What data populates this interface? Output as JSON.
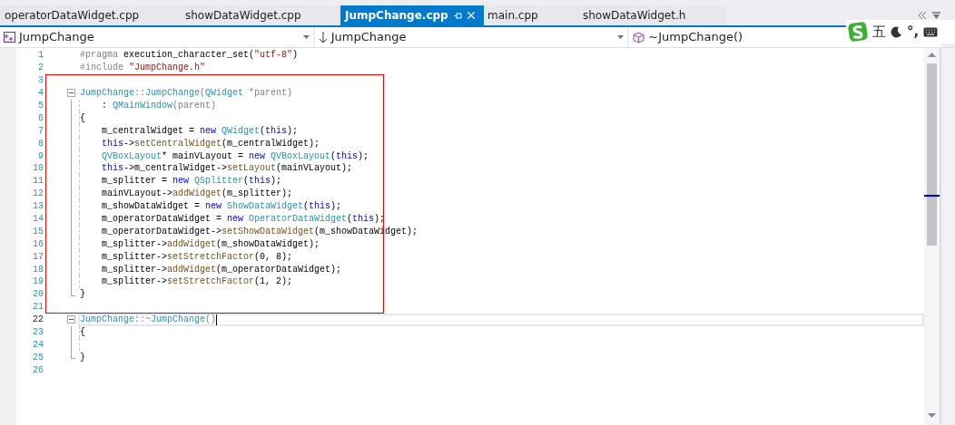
{
  "tabs": [
    {
      "label": "operatorDataWidget.cpp",
      "selected": false
    },
    {
      "label": "showDataWidget.cpp",
      "selected": false
    },
    {
      "label": "JumpChange.cpp",
      "selected": true
    },
    {
      "label": "main.cpp",
      "selected": false
    },
    {
      "label": "showDataWidget.h",
      "selected": false
    }
  ],
  "navigation": [
    {
      "kind": "class",
      "label": "JumpChange"
    },
    {
      "kind": "scope",
      "label": "JumpChange"
    },
    {
      "kind": "member",
      "label": "~JumpChange()"
    }
  ],
  "ime_toolbar": {
    "mode": "五",
    "punctuation": "°,"
  },
  "sections": [
    {
      "boxed": false,
      "lines": [
        {
          "number": "1",
          "kind": "plain",
          "current": false,
          "indented": false,
          "tokens": [
            {
              "kind": "pp",
              "text": "#pragma"
            },
            {
              "kind": "plain",
              "text": " execution_character_set("
            },
            {
              "kind": "str",
              "text": "\"utf-8\""
            },
            {
              "kind": "plain",
              "text": ")"
            }
          ]
        },
        {
          "number": "2",
          "kind": "plain",
          "current": false,
          "indented": false,
          "tokens": [
            {
              "kind": "pp",
              "text": "#include "
            },
            {
              "kind": "str",
              "text": "\"JumpChange.h\""
            }
          ]
        }
      ]
    },
    {
      "boxed": true,
      "lines": [
        {
          "number": "3",
          "kind": "plain",
          "current": false,
          "indented": false
        },
        {
          "number": "4",
          "kind": "fold-start",
          "current": false,
          "indented": false,
          "tokens": [
            {
              "kind": "type",
              "text": "JumpChange"
            },
            {
              "kind": "pp",
              "text": "::"
            },
            {
              "kind": "type",
              "text": "JumpChange"
            },
            {
              "kind": "pp",
              "text": "("
            },
            {
              "kind": "type",
              "text": "QWidget "
            },
            {
              "kind": "param",
              "text": "*parent"
            },
            {
              "kind": "pp",
              "text": ")"
            }
          ]
        },
        {
          "number": "5",
          "kind": "block",
          "current": false,
          "indented": true,
          "tokens": [
            {
              "kind": "plain",
              "text": ": "
            },
            {
              "kind": "type",
              "text": "QMainWindow"
            },
            {
              "kind": "param",
              "text": "(parent)"
            }
          ]
        },
        {
          "number": "6",
          "kind": "block",
          "current": false,
          "indented": false,
          "tokens": [
            {
              "kind": "plain",
              "text": "{"
            }
          ]
        },
        {
          "number": "7",
          "kind": "block",
          "current": false,
          "indented": true,
          "tokens": [
            {
              "kind": "plain",
              "text": "m_centralWidget = "
            },
            {
              "kind": "kw",
              "text": "new "
            },
            {
              "kind": "type",
              "text": "QWidget"
            },
            {
              "kind": "plain",
              "text": "("
            },
            {
              "kind": "kw",
              "text": "this"
            },
            {
              "kind": "plain",
              "text": ");"
            }
          ]
        },
        {
          "number": "8",
          "kind": "block",
          "current": false,
          "indented": true,
          "tokens": [
            {
              "kind": "kw",
              "text": "this"
            },
            {
              "kind": "plain",
              "text": "->"
            },
            {
              "kind": "fn",
              "text": "setCentralWidget"
            },
            {
              "kind": "plain",
              "text": "(m_centralWidget);"
            }
          ]
        },
        {
          "number": "9",
          "kind": "block",
          "current": false,
          "indented": true,
          "tokens": [
            {
              "kind": "type",
              "text": "QVBoxLayout"
            },
            {
              "kind": "plain",
              "text": "* mainVLayout = "
            },
            {
              "kind": "kw",
              "text": "new "
            },
            {
              "kind": "type",
              "text": "QVBoxLayout"
            },
            {
              "kind": "plain",
              "text": "("
            },
            {
              "kind": "kw",
              "text": "this"
            },
            {
              "kind": "plain",
              "text": ");"
            }
          ]
        },
        {
          "number": "10",
          "kind": "block",
          "current": false,
          "indented": true,
          "tokens": [
            {
              "kind": "kw",
              "text": "this"
            },
            {
              "kind": "plain",
              "text": "->m_centralWidget->"
            },
            {
              "kind": "fn",
              "text": "setLayout"
            },
            {
              "kind": "plain",
              "text": "(mainVLayout);"
            }
          ]
        },
        {
          "number": "11",
          "kind": "block",
          "current": false,
          "indented": true,
          "tokens": [
            {
              "kind": "plain",
              "text": "m_splitter = "
            },
            {
              "kind": "kw",
              "text": "new "
            },
            {
              "kind": "type",
              "text": "QSplitter"
            },
            {
              "kind": "plain",
              "text": "("
            },
            {
              "kind": "kw",
              "text": "this"
            },
            {
              "kind": "plain",
              "text": ");"
            }
          ]
        },
        {
          "number": "12",
          "kind": "block",
          "current": false,
          "indented": true,
          "tokens": [
            {
              "kind": "plain",
              "text": "mainVLayout->"
            },
            {
              "kind": "fn",
              "text": "addWidget"
            },
            {
              "kind": "plain",
              "text": "(m_splitter);"
            }
          ]
        },
        {
          "number": "13",
          "kind": "block",
          "current": false,
          "indented": true,
          "tokens": [
            {
              "kind": "plain",
              "text": "m_showDataWidget = "
            },
            {
              "kind": "kw",
              "text": "new "
            },
            {
              "kind": "type",
              "text": "ShowDataWidget"
            },
            {
              "kind": "plain",
              "text": "("
            },
            {
              "kind": "kw",
              "text": "this"
            },
            {
              "kind": "plain",
              "text": ");"
            }
          ]
        },
        {
          "number": "14",
          "kind": "block",
          "current": false,
          "indented": true,
          "tokens": [
            {
              "kind": "plain",
              "text": "m_operatorDataWidget = "
            },
            {
              "kind": "kw",
              "text": "new "
            },
            {
              "kind": "type",
              "text": "OperatorDataWidget"
            },
            {
              "kind": "plain",
              "text": "("
            },
            {
              "kind": "kw",
              "text": "this"
            },
            {
              "kind": "plain",
              "text": ");"
            }
          ]
        },
        {
          "number": "15",
          "kind": "block",
          "current": false,
          "indented": true,
          "tokens": [
            {
              "kind": "plain",
              "text": "m_operatorDataWidget->"
            },
            {
              "kind": "fn",
              "text": "setShowDataWidget"
            },
            {
              "kind": "plain",
              "text": "(m_showDataWidget);"
            }
          ]
        },
        {
          "number": "16",
          "kind": "block",
          "current": false,
          "indented": true,
          "tokens": [
            {
              "kind": "plain",
              "text": "m_splitter->"
            },
            {
              "kind": "fn",
              "text": "addWidget"
            },
            {
              "kind": "plain",
              "text": "(m_showDataWidget);"
            }
          ]
        },
        {
          "number": "17",
          "kind": "block",
          "current": false,
          "indented": true,
          "tokens": [
            {
              "kind": "plain",
              "text": "m_splitter->"
            },
            {
              "kind": "fn",
              "text": "setStretchFactor"
            },
            {
              "kind": "plain",
              "text": "(0, 8);"
            }
          ]
        },
        {
          "number": "18",
          "kind": "block",
          "current": false,
          "indented": true,
          "tokens": [
            {
              "kind": "plain",
              "text": "m_splitter->"
            },
            {
              "kind": "fn",
              "text": "addWidget"
            },
            {
              "kind": "plain",
              "text": "(m_operatorDataWidget);"
            }
          ]
        },
        {
          "number": "19",
          "kind": "block",
          "current": false,
          "indented": true,
          "tokens": [
            {
              "kind": "plain",
              "text": "m_splitter->"
            },
            {
              "kind": "fn",
              "text": "setStretchFactor"
            },
            {
              "kind": "plain",
              "text": "(1, 2);"
            }
          ]
        },
        {
          "number": "20",
          "kind": "fold-end",
          "current": false,
          "indented": false,
          "tokens": [
            {
              "kind": "plain",
              "text": "}"
            }
          ]
        },
        {
          "number": "21",
          "kind": "plain",
          "current": false,
          "indented": false
        }
      ]
    },
    {
      "boxed": false,
      "lines": [
        {
          "number": "22",
          "kind": "fold-start",
          "current": true,
          "indented": false,
          "tokens": [
            {
              "kind": "type",
              "text": "JumpChange"
            },
            {
              "kind": "pp",
              "text": "::~"
            },
            {
              "kind": "type",
              "text": "JumpChange"
            },
            {
              "kind": "pp",
              "text": "()"
            }
          ]
        },
        {
          "number": "23",
          "kind": "block",
          "current": false,
          "indented": false,
          "tokens": [
            {
              "kind": "plain",
              "text": "{"
            }
          ]
        },
        {
          "number": "24",
          "kind": "block",
          "current": false,
          "indented": false
        },
        {
          "number": "25",
          "kind": "fold-end",
          "current": false,
          "indented": false,
          "tokens": [
            {
              "kind": "plain",
              "text": "}"
            }
          ]
        },
        {
          "number": "26",
          "kind": "plain",
          "current": false,
          "indented": false
        }
      ]
    }
  ]
}
